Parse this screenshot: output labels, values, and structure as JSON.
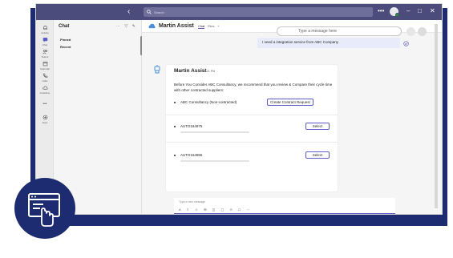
{
  "titlebar": {
    "search_placeholder": "Search",
    "more": "•••",
    "minimize": "–",
    "maximize": "□",
    "close": "✕"
  },
  "rail": [
    {
      "label": "Activity",
      "icon": "bell-icon"
    },
    {
      "label": "Chat",
      "icon": "chat-icon"
    },
    {
      "label": "Teams",
      "icon": "teams-icon"
    },
    {
      "label": "Calendar",
      "icon": "calendar-icon"
    },
    {
      "label": "Calls",
      "icon": "phone-icon"
    },
    {
      "label": "OneDrive",
      "icon": "cloud-icon"
    },
    {
      "label": "Apps",
      "icon": "apps-icon"
    }
  ],
  "chatlist": {
    "title": "Chat",
    "icons": "⋯ ▽ ✎",
    "items": [
      "Pinned",
      "Recent"
    ]
  },
  "header": {
    "name": "Martin Assist",
    "tabs": [
      "Chat",
      "Files"
    ],
    "add_tab": "+"
  },
  "user_message": "I need a integration service from ABC Company",
  "bot": {
    "name": "Martin Assist",
    "time": "4:21 PM",
    "intro": "Before You Consider ABC Consultancy, we recommend that you review & Compare their cycle time with other contracted suppliers:",
    "rows": [
      {
        "label": "ABC Consultancy (Non-contracted)",
        "button": "Create Contract Request"
      },
      {
        "label": "AUTO164975",
        "button": "Select"
      },
      {
        "label": "AUTO164955",
        "button": "Select"
      }
    ]
  },
  "compose": {
    "placeholder": "Type a new message",
    "tools": "A ⇧ ☺ ⊞ ◫ ▢ ⊙ ☖ ⋯",
    "input_placeholder": "Type a message here"
  },
  "colors": {
    "brand_navy": "#1d2b70",
    "titlebar": "#4b4b7c",
    "accent": "#5b5fc7"
  }
}
